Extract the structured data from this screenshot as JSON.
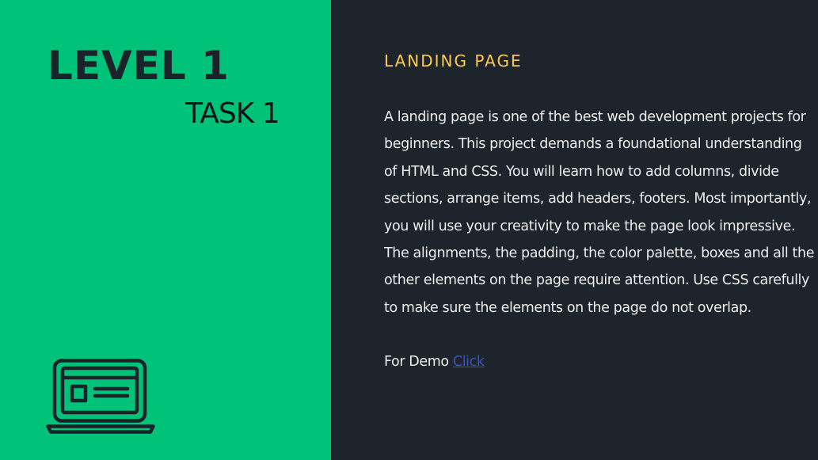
{
  "left": {
    "level_title": "LEVEL 1",
    "task_title": "TASK 1",
    "icon": "laptop-icon",
    "background_color": "#00c278"
  },
  "right": {
    "heading": "LANDING PAGE",
    "description": "A landing page is one of the best web development projects for beginners. This project demands a foundational understanding of HTML and CSS. You will learn how to add columns, divide sections, arrange items, add headers, footers. Most importantly, you will use your creativity to make the page look impressive. The alignments, the padding, the color palette, boxes and all the other elements on the page require attention. Use CSS carefully to make sure the elements on the page do not overlap.",
    "demo_label": "For Demo",
    "demo_link_label": "Click",
    "background_color": "#1d242b",
    "heading_color": "#ffc94d",
    "link_color": "#3b54b8"
  }
}
